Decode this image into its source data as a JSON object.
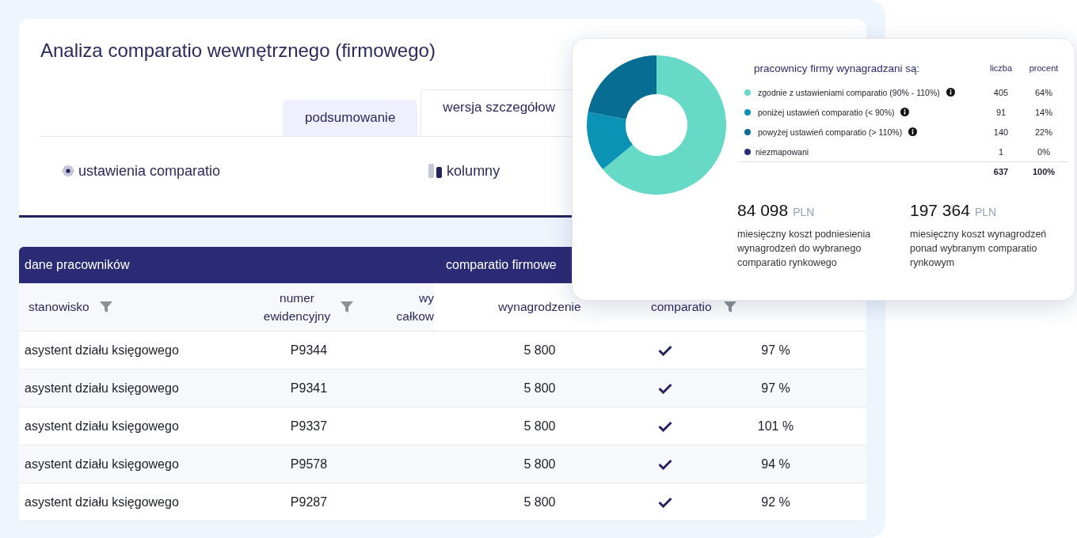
{
  "title": "Analiza comparatio wewnętrznego (firmowego)",
  "tabs": [
    {
      "label": "podsumowanie",
      "selected": false
    },
    {
      "label": "wersja szczegółow",
      "selected": true
    }
  ],
  "tools": [
    {
      "kind": "settings",
      "label": "ustawienia comparatio"
    },
    {
      "kind": "columns",
      "label": "kolumny"
    }
  ],
  "table": {
    "groups": [
      {
        "label": "dane pracowników"
      },
      {
        "label": "comparatio firmowe"
      }
    ],
    "columns": [
      {
        "label": "stanowisko",
        "filter": true
      },
      {
        "label": "numer\newidencyjny",
        "filter": true
      },
      {
        "label": "wy\ncałkow",
        "filter": false
      },
      {
        "label": "wynagrodzenie",
        "filter": false
      },
      {
        "label": "comparatio",
        "filter": true
      }
    ],
    "rows": [
      {
        "position": "asystent działu księgowego",
        "number": "P9344",
        "salary": "5 800",
        "checked": true,
        "comparatio": "97 %"
      },
      {
        "position": "asystent działu księgowego",
        "number": "P9341",
        "salary": "5 800",
        "checked": true,
        "comparatio": "97 %"
      },
      {
        "position": "asystent działu księgowego",
        "number": "P9337",
        "salary": "5 800",
        "checked": true,
        "comparatio": "101 %"
      },
      {
        "position": "asystent działu księgowego",
        "number": "P9578",
        "salary": "5 800",
        "checked": true,
        "comparatio": "94 %"
      },
      {
        "position": "asystent działu księgowego",
        "number": "P9287",
        "salary": "5 800",
        "checked": true,
        "comparatio": "92 %"
      }
    ]
  },
  "summary": {
    "title": "pracownicy firmy wynagradzani są:",
    "percent_header": "procent",
    "items": [
      {
        "info": true,
        "color": "#66dac6",
        "count": "405",
        "percent": "64%"
      },
      {
        "info": true,
        "color": "#0a93b5",
        "count": "91",
        "percent": "14%"
      },
      {
        "info": true,
        "color": "#086d93",
        "count": "140",
        "percent": "22%"
      },
      {
        "info": false,
        "color": "#2b2a75",
        "count": "1",
        "percent": "0%"
      }
    ],
    "total_count": "637",
    "total_percent": "100%",
    "chart_data": {
      "type": "donut",
      "categories": [
        "zgodnie z ustawieniami comparatio (90% - 110%)",
        "poniżej ustawień comparatio (< 90%)",
        "powyżej ustawień comparatio (> 110%)",
        "niezmapowani"
      ],
      "series": [
        {
          "name": "liczba",
          "values": [
            64,
            14,
            22,
            0
          ]
        }
      ]
    },
    "stats": [
      {
        "value": "84 098",
        "unit": "PLN",
        "description": "miesięczny koszt podniesienia wynagrodzeń do wybranego comparatio rynkowego"
      },
      {
        "value": "197 364",
        "unit": "PLN",
        "description": "miesięczny koszt wynagrodzeń ponad wybranym comparatio rynkowym"
      }
    ]
  }
}
